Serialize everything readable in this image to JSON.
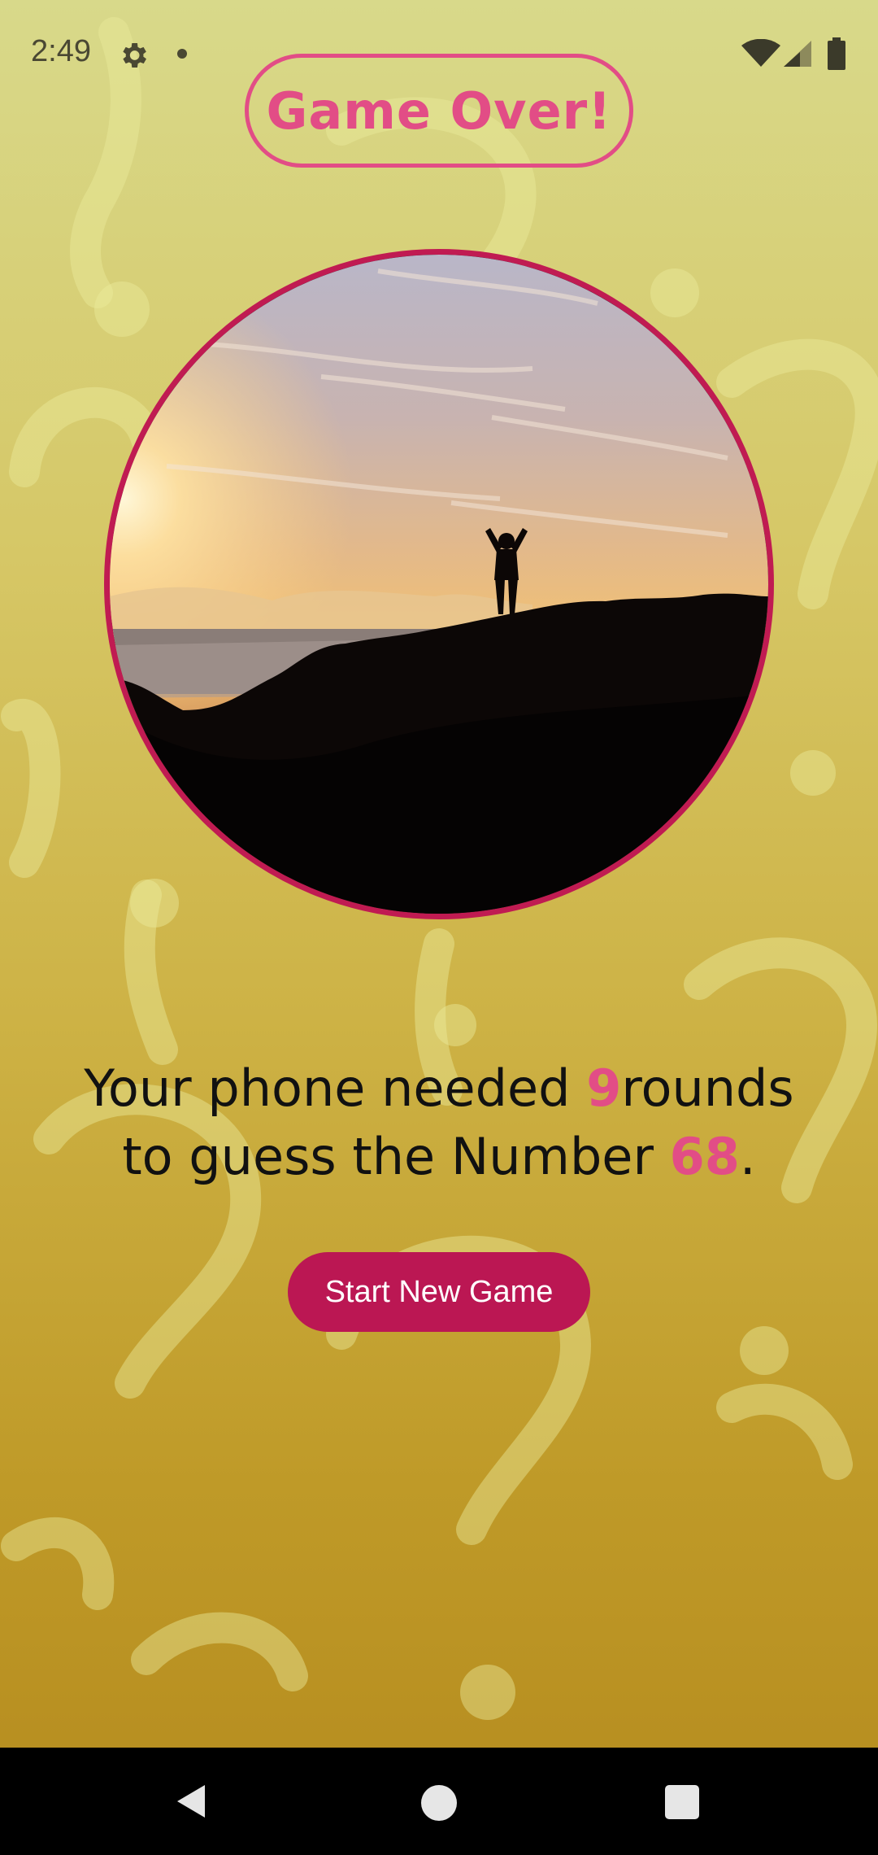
{
  "status_bar": {
    "time": "2:49",
    "icons": [
      "gear-icon",
      "notification-dot",
      "wifi-icon",
      "signal-icon",
      "battery-icon"
    ]
  },
  "title": "Game Over!",
  "image": {
    "description_icon": "person-summit-sunset-photo"
  },
  "summary": {
    "line1_prefix": "Your phone needed ",
    "rounds": "9",
    "line1_suffix": "rounds",
    "line2_prefix": "to guess the Number ",
    "number": "68",
    "line2_suffix": "."
  },
  "start_button_label": "Start New Game",
  "nav_bar": {
    "icons": [
      "back-icon",
      "home-icon",
      "recents-icon"
    ]
  },
  "colors": {
    "accent": "#e24d86",
    "button": "#bb1753",
    "border": "#c01b52"
  }
}
